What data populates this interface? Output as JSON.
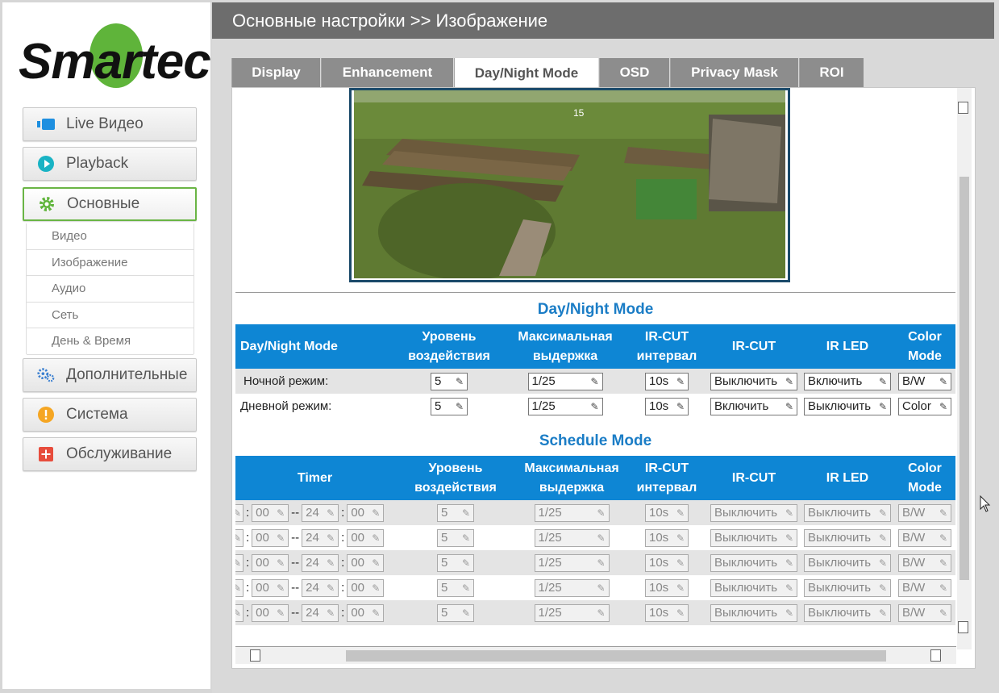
{
  "brand": {
    "logo_text": "Smartec",
    "accent": "#5fb43a"
  },
  "header": {
    "title": "Основные настройки >> Изображение"
  },
  "sidebar": {
    "buttons": [
      {
        "label": "Live Видео",
        "icon": "video-icon"
      },
      {
        "label": "Playback",
        "icon": "play-icon"
      },
      {
        "label": "Основные",
        "icon": "gear-icon",
        "active": true
      },
      {
        "label": "Дополнительные",
        "icon": "gears-icon"
      },
      {
        "label": "Система",
        "icon": "warning-icon"
      },
      {
        "label": "Обслуживание",
        "icon": "plus-icon"
      }
    ],
    "submenu": [
      "Видео",
      "Изображение",
      "Аудио",
      "Сеть",
      "День & Время"
    ]
  },
  "tabs": [
    {
      "label": "Display"
    },
    {
      "label": "Enhancement"
    },
    {
      "label": "Day/Night Mode",
      "active": true
    },
    {
      "label": "OSD"
    },
    {
      "label": "Privacy Mask"
    },
    {
      "label": "ROI"
    }
  ],
  "daynight": {
    "title": "Day/Night Mode",
    "headers": [
      "Day/Night Mode",
      "Уровень воздействия",
      "Максимальная выдержка",
      "IR-CUT интервал",
      "IR-CUT",
      "IR LED",
      "Color Mode"
    ],
    "rows": [
      {
        "label": "Ночной режим:",
        "level": "5",
        "shutter": "1/25",
        "interval": "10s",
        "ircut": "Выключить",
        "irled": "Включить",
        "color": "B/W"
      },
      {
        "label": "Дневной режим:",
        "level": "5",
        "shutter": "1/25",
        "interval": "10s",
        "ircut": "Включить",
        "irled": "Выключить",
        "color": "Color"
      }
    ]
  },
  "schedule": {
    "title": "Schedule Mode",
    "headers": [
      "Timer",
      "Уровень воздействия",
      "Максимальная выдержка",
      "IR-CUT интервал",
      "IR-CUT",
      "IR LED",
      "Color Mode"
    ],
    "rows": [
      {
        "start_min": "00",
        "end_hour": "24",
        "end_min": "00",
        "level": "5",
        "shutter": "1/25",
        "interval": "10s",
        "ircut": "Выключить",
        "irled": "Выключить",
        "color": "B/W"
      },
      {
        "start_min": "00",
        "end_hour": "24",
        "end_min": "00",
        "level": "5",
        "shutter": "1/25",
        "interval": "10s",
        "ircut": "Выключить",
        "irled": "Выключить",
        "color": "B/W"
      },
      {
        "start_min": "00",
        "end_hour": "24",
        "end_min": "00",
        "level": "5",
        "shutter": "1/25",
        "interval": "10s",
        "ircut": "Выключить",
        "irled": "Выключить",
        "color": "B/W"
      },
      {
        "start_min": "00",
        "end_hour": "24",
        "end_min": "00",
        "level": "5",
        "shutter": "1/25",
        "interval": "10s",
        "ircut": "Выключить",
        "irled": "Выключить",
        "color": "B/W"
      },
      {
        "start_min": "00",
        "end_hour": "24",
        "end_min": "00",
        "level": "5",
        "shutter": "1/25",
        "interval": "10s",
        "ircut": "Выключить",
        "irled": "Выключить",
        "color": "B/W"
      }
    ],
    "separators": {
      "colon": ":",
      "dash": "--"
    }
  },
  "video": {
    "overlay_text": "15"
  }
}
